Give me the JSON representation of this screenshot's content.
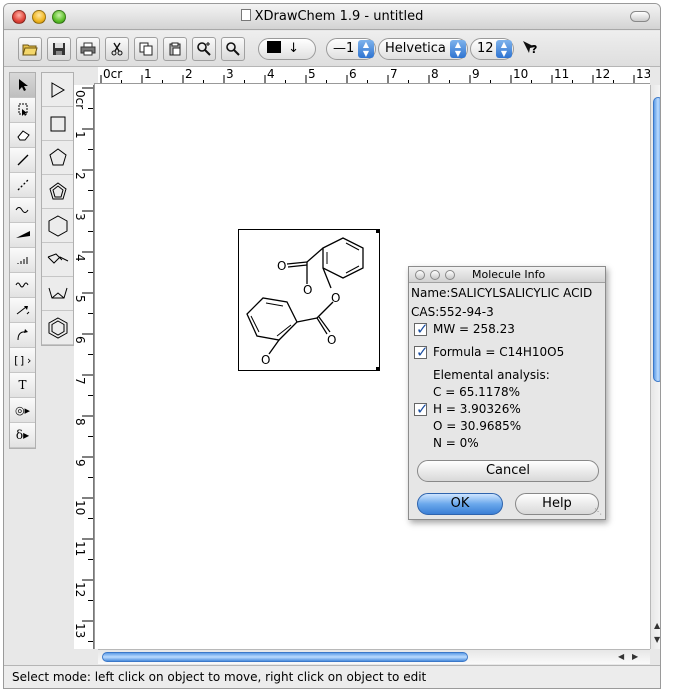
{
  "window": {
    "title": "XDrawChem 1.9 - untitled"
  },
  "toolbar": {
    "line_width": "1",
    "font_family": "Helvetica",
    "font_size": "12"
  },
  "rulers": {
    "horizontal": [
      "0cr",
      "1",
      "2",
      "3",
      "4",
      "5",
      "6",
      "7",
      "8",
      "9",
      "10",
      "11",
      "12",
      "13"
    ],
    "vertical": [
      "0cr",
      "1",
      "2",
      "3",
      "4",
      "5",
      "6",
      "7",
      "8",
      "9",
      "10",
      "11",
      "12",
      "13"
    ]
  },
  "toolbox": {
    "tools": [
      "select-arrow",
      "lasso",
      "eraser",
      "single-bond",
      "dashed-bond",
      "wavy-line",
      "wedge-bond",
      "hashed-bond",
      "wavy-bond",
      "arrow",
      "curved-arrow",
      "bracket",
      "text",
      "symbol",
      "delta"
    ]
  },
  "ring_palette": {
    "tools": [
      "triangle",
      "square",
      "pentagon",
      "pentagon-alt",
      "hexagon",
      "chair",
      "boat",
      "benzene"
    ]
  },
  "molecule": {
    "atoms": [
      "O",
      "O",
      "O",
      "O"
    ]
  },
  "molecule_info": {
    "title": "Molecule Info",
    "name": "Name:SALICYLSALICYLIC ACID",
    "cas": "CAS:552-94-3",
    "mw": "MW = 258.23",
    "formula": "Formula = C14H10O5",
    "elemental_header": "Elemental analysis:",
    "c": "C = 65.1178%",
    "h": "H = 3.90326%",
    "o": "O = 30.9685%",
    "n": "N = 0%",
    "cancel": "Cancel",
    "ok": "OK",
    "help": "Help",
    "mw_checked": true,
    "formula_checked": true,
    "elemental_checked": true
  },
  "status": {
    "text": "Select mode: left click on object to move, right click on object to edit"
  }
}
